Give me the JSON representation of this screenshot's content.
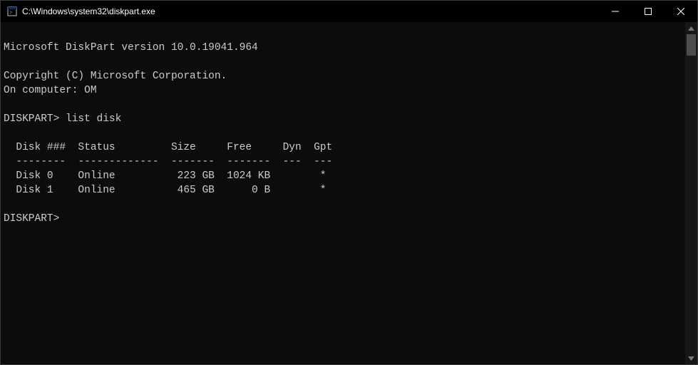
{
  "window": {
    "title": "C:\\Windows\\system32\\diskpart.exe"
  },
  "terminal": {
    "header_line": "Microsoft DiskPart version 10.0.19041.964",
    "copyright": "Copyright (C) Microsoft Corporation.",
    "computer_line": "On computer: OM",
    "prompt1": "DISKPART> list disk",
    "table_header": "  Disk ###  Status         Size     Free     Dyn  Gpt",
    "table_sep": "  --------  -------------  -------  -------  ---  ---",
    "rows": [
      "  Disk 0    Online          223 GB  1024 KB        *",
      "  Disk 1    Online          465 GB      0 B        *"
    ],
    "prompt2": "DISKPART>",
    "disks": [
      {
        "id": "Disk 0",
        "status": "Online",
        "size": "223 GB",
        "free": "1024 KB",
        "dyn": "",
        "gpt": "*"
      },
      {
        "id": "Disk 1",
        "status": "Online",
        "size": "465 GB",
        "free": "0 B",
        "dyn": "",
        "gpt": "*"
      }
    ]
  }
}
